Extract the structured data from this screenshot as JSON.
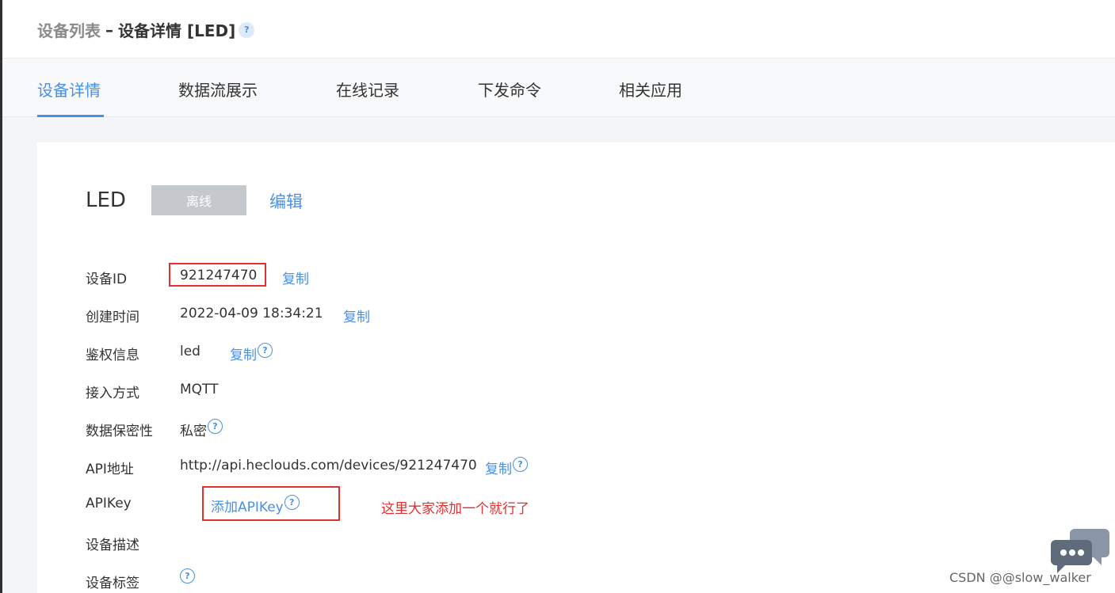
{
  "breadcrumb": {
    "parent": "设备列表",
    "separator": "–",
    "current": "设备详情 [LED]",
    "help": "?"
  },
  "tabs": [
    {
      "label": "设备详情",
      "active": true
    },
    {
      "label": "数据流展示",
      "active": false
    },
    {
      "label": "在线记录",
      "active": false
    },
    {
      "label": "下发命令",
      "active": false
    },
    {
      "label": "相关应用",
      "active": false
    }
  ],
  "device": {
    "name": "LED",
    "status": "离线",
    "edit_label": "编辑"
  },
  "fields": {
    "device_id": {
      "label": "设备ID",
      "value": "921247470",
      "action": "复制"
    },
    "created": {
      "label": "创建时间",
      "value": "2022-04-09 18:34:21",
      "action": "复制"
    },
    "auth": {
      "label": "鉴权信息",
      "value": "led",
      "action": "复制"
    },
    "protocol": {
      "label": "接入方式",
      "value": "MQTT"
    },
    "privacy": {
      "label": "数据保密性",
      "value": "私密"
    },
    "api_address": {
      "label": "API地址",
      "value": "http://api.heclouds.com/devices/921247470",
      "action": "复制"
    },
    "apikey": {
      "label": "APIKey",
      "action": "添加APIKey"
    },
    "description": {
      "label": "设备描述"
    },
    "tags": {
      "label": "设备标签"
    }
  },
  "help_glyph": "?",
  "annotation_note": "这里大家添加一个就行了",
  "watermark": "CSDN @@slow_walker",
  "colors": {
    "accent": "#4a90e2",
    "annotation": "#e03030",
    "status_offline": "#c5c8cc",
    "chat_widget": "#5f6b7a"
  }
}
